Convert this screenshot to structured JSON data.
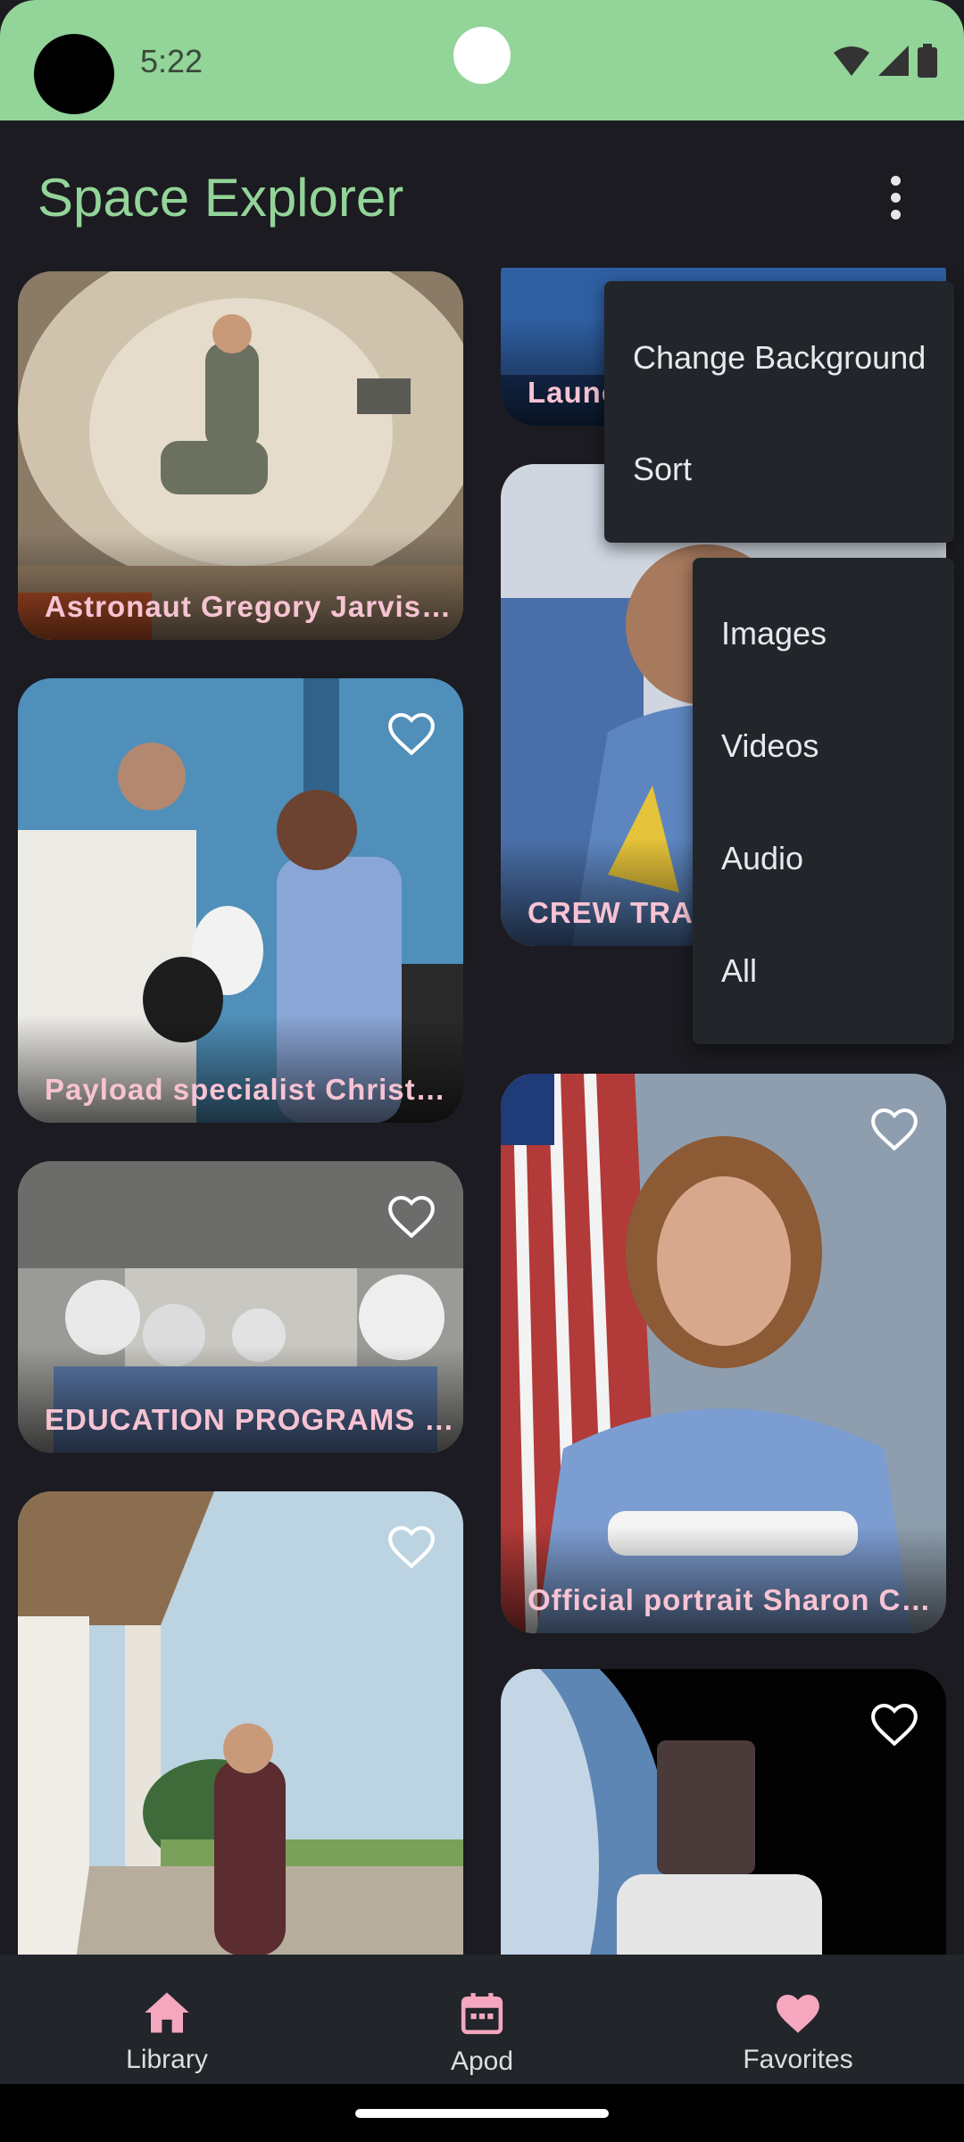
{
  "status_bar": {
    "time": "5:22"
  },
  "app_bar": {
    "title": "Space Explorer",
    "menu_icon": "more-vert-icon"
  },
  "cards": [
    {
      "caption": "Astronaut Gregory Jarvis d...",
      "favorite": false
    },
    {
      "caption": "Launc",
      "favorite": false
    },
    {
      "caption": "CREW TRA",
      "favorite": false
    },
    {
      "caption": "Payload specialist Christa ...",
      "favorite": false
    },
    {
      "caption": "EDUCATION PROGRAMS - ...",
      "favorite": false
    },
    {
      "caption": "Official portrait Sharon Chr...",
      "favorite": false
    },
    {
      "caption": "",
      "favorite": false
    },
    {
      "caption": "",
      "favorite": false
    }
  ],
  "overflow_menu": {
    "items": [
      "Change Background",
      "Sort"
    ]
  },
  "sort_submenu": {
    "items": [
      "Images",
      "Videos",
      "Audio",
      "All"
    ]
  },
  "bottom_nav": {
    "items": [
      {
        "label": "Library",
        "icon": "home-icon"
      },
      {
        "label": "Apod",
        "icon": "calendar-icon"
      },
      {
        "label": "Favorites",
        "icon": "heart-icon"
      }
    ]
  },
  "colors": {
    "accent": "#93d498",
    "caption": "#f7c3d3",
    "background": "#1b1b21",
    "nav_icon": "#f4a7bf"
  }
}
